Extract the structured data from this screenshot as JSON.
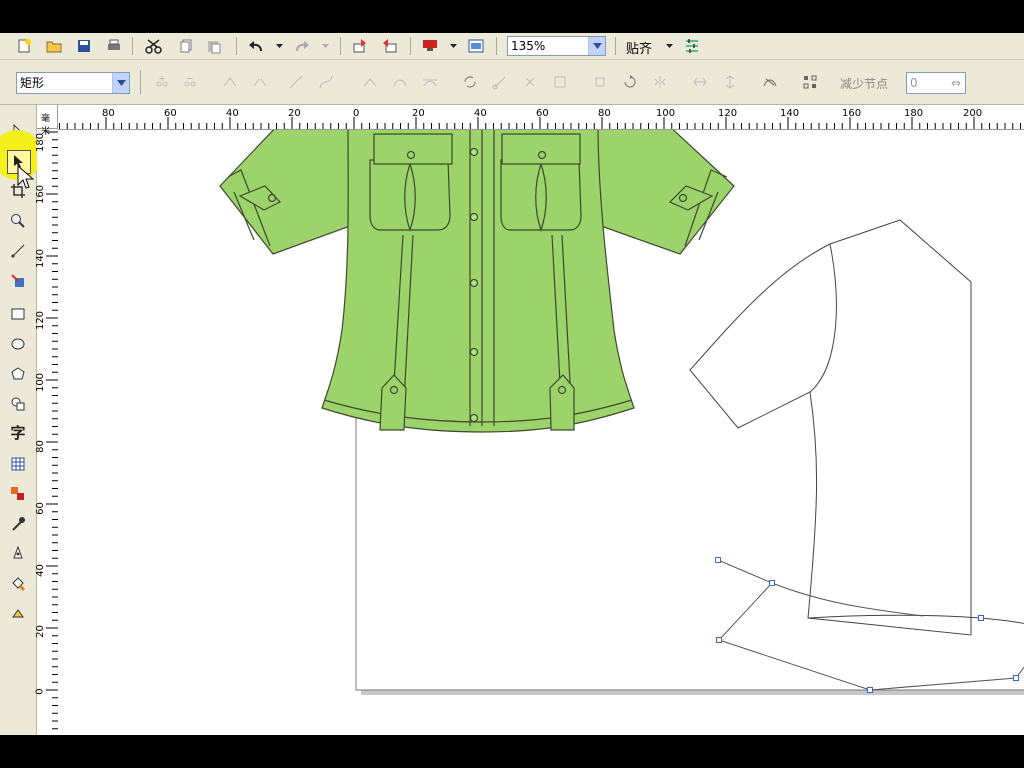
{
  "toolbar": {
    "zoom_value": "135%",
    "snap_label": "贴齐",
    "object_type": "矩形",
    "reduce_nodes_label": "减少节点",
    "reduce_nodes_value": "0"
  },
  "rulers": {
    "horizontal_ticks": [
      "80",
      "60",
      "40",
      "20",
      "0",
      "20",
      "40",
      "60",
      "80",
      "100",
      "120",
      "140",
      "160",
      "180",
      "200"
    ],
    "vertical_ticks": [
      "180",
      "160",
      "140",
      "120",
      "100",
      "80",
      "60",
      "40",
      "20",
      "0"
    ],
    "unit": "毫米"
  },
  "tools": [
    "pick-tool",
    "shape-tool",
    "crop-tool",
    "zoom-tool",
    "freehand-tool",
    "smart-fill-tool",
    "rectangle-tool",
    "ellipse-tool",
    "polygon-tool",
    "basic-shapes-tool",
    "text-tool",
    "table-tool",
    "interactive-blend-tool",
    "eyedropper-tool",
    "outline-tool",
    "fill-tool",
    "interactive-fill-tool"
  ],
  "text_tool_glyph": "字",
  "colors": {
    "shirt_fill": "#9dd36b",
    "highlight": "#f5ef1c",
    "node": "#3366cc"
  }
}
